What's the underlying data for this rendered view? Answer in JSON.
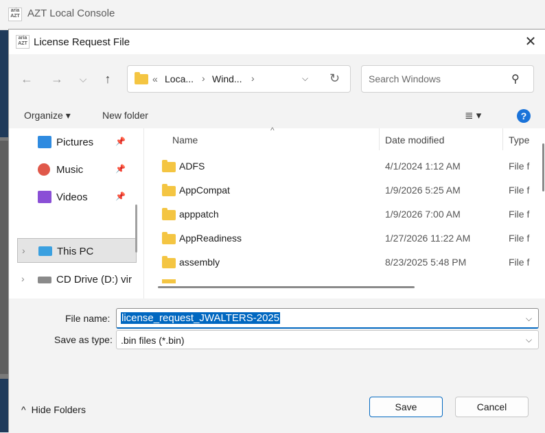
{
  "background_app": {
    "title": "AZT Local Console",
    "logo_text_top": "aria",
    "logo_text_bottom": "AZT"
  },
  "dialog": {
    "title": "License Request File",
    "close_glyph": "✕",
    "nav": {
      "back_glyph": "←",
      "forward_glyph": "→",
      "recent_glyph": "⌵",
      "up_glyph": "↑"
    },
    "address": {
      "overflow": "«",
      "crumbs": [
        "Loca...",
        "Wind..."
      ],
      "separator": "›",
      "refresh_glyph": "↻",
      "dropdown_glyph": "⌵"
    },
    "search": {
      "placeholder": "Search Windows",
      "icon_glyph": "⚲"
    },
    "toolbar": {
      "organize": "Organize ▾",
      "new_folder": "New folder",
      "view_glyph": "≣ ▾",
      "help_glyph": "?"
    },
    "left_nav": {
      "items": [
        {
          "label": "Pictures",
          "icon": "pictures-icon",
          "pinned": true
        },
        {
          "label": "Music",
          "icon": "music-icon",
          "pinned": true
        },
        {
          "label": "Videos",
          "icon": "videos-icon",
          "pinned": true
        },
        {
          "label": "This PC",
          "icon": "this-pc-icon",
          "pinned": false,
          "selected": true
        },
        {
          "label": "CD Drive (D:) vir",
          "icon": "cd-drive-icon",
          "pinned": false
        }
      ],
      "pin_glyph": "📌",
      "expand_glyph": "›"
    },
    "file_list": {
      "columns": [
        "Name",
        "Date modified",
        "Type"
      ],
      "sort_glyph": "^",
      "rows": [
        {
          "name": "ADFS",
          "date": "4/1/2024 1:12 AM",
          "type": "File f"
        },
        {
          "name": "AppCompat",
          "date": "1/9/2026 5:25 AM",
          "type": "File f"
        },
        {
          "name": "apppatch",
          "date": "1/9/2026 7:00 AM",
          "type": "File f"
        },
        {
          "name": "AppReadiness",
          "date": "1/27/2026 11:22 AM",
          "type": "File f"
        },
        {
          "name": "assembly",
          "date": "8/23/2025 5:48 PM",
          "type": "File f"
        }
      ]
    },
    "file_name_label": "File name:",
    "file_name_value": "license_request_JWALTERS-2025",
    "save_type_label": "Save as type:",
    "save_type_value": ".bin files (*.bin)",
    "hide_folders": "Hide Folders",
    "hide_glyph": "^",
    "save_button": "Save",
    "cancel_button": "Cancel",
    "colors": {
      "accent": "#0067c0",
      "folder": "#f4c542",
      "help": "#1a73d9"
    }
  }
}
